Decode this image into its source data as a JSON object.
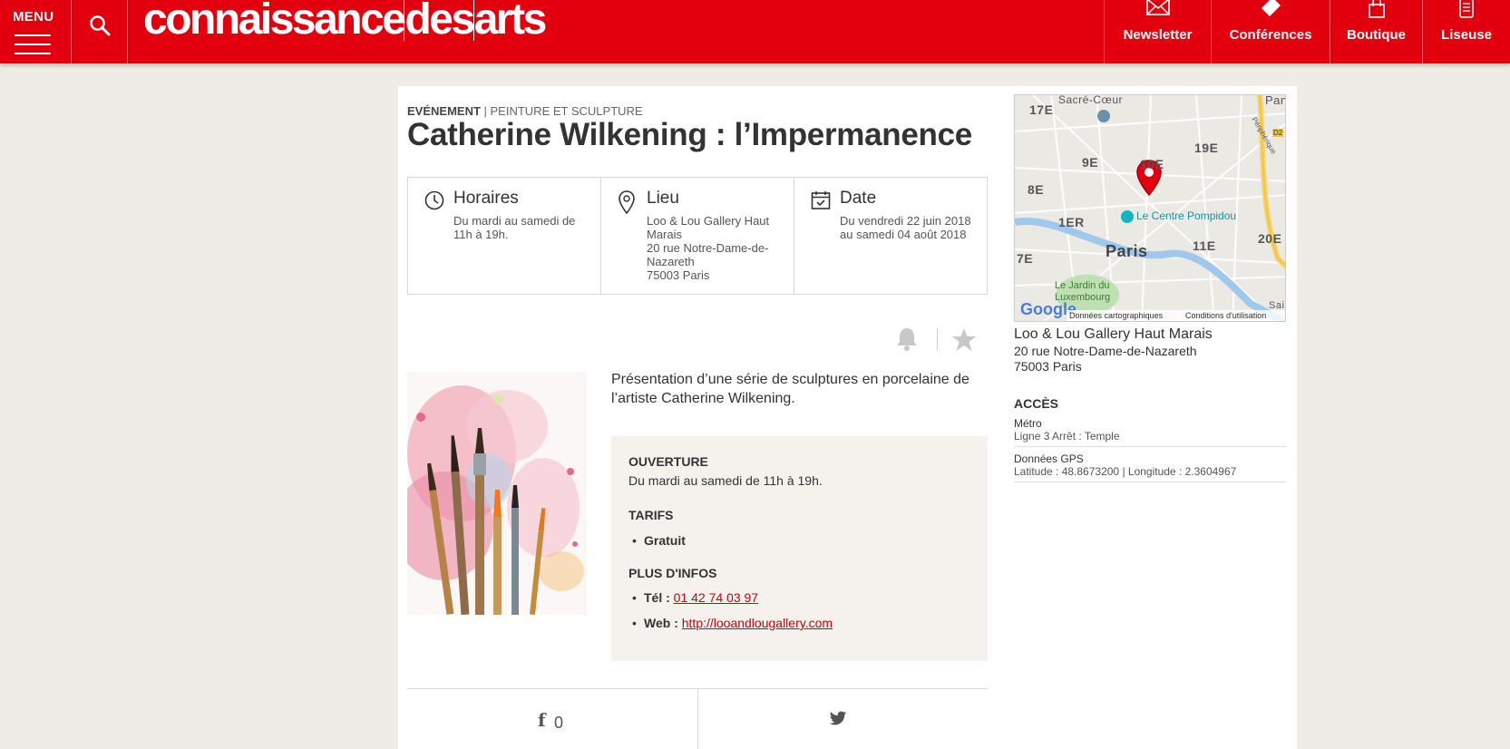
{
  "header": {
    "menu_label": "MENU",
    "logo_part1": "connaissance",
    "logo_part2": "des",
    "logo_part3": "arts",
    "nav": [
      {
        "label": "Newsletter",
        "icon": "envelope-icon"
      },
      {
        "label": "Conférences",
        "icon": "ticket-icon"
      },
      {
        "label": "Boutique",
        "icon": "shopping-bag-icon"
      },
      {
        "label": "Liseuse",
        "icon": "tablet-icon"
      }
    ]
  },
  "article": {
    "category_type": "EVÉNEMENT",
    "category_sep": " | ",
    "category_name": "PEINTURE ET SCULPTURE",
    "title": "Catherine Wilkening : l’Impermanence",
    "info": {
      "hours_title": "Horaires",
      "hours_text": "Du mardi au samedi de 11h à 19h.",
      "place_title": "Lieu",
      "place_lines": [
        "Loo & Lou Gallery Haut Marais",
        "20 rue Notre-Dame-de-Nazareth",
        "75003 Paris"
      ],
      "date_title": "Date",
      "date_text": "Du vendredi 22 juin 2018 au samedi 04 août 2018"
    },
    "description": "Présentation d’une série de sculptures en porcelaine de l’artiste Catherine Wilkening.",
    "details": {
      "opening_title": "OUVERTURE",
      "opening_text": "Du mardi au samedi de 11h à 19h.",
      "prices_title": "TARIFS",
      "price_item": "Gratuit",
      "more_title": "PLUS D'INFOS",
      "tel_label": "Tél : ",
      "tel_value": "01 42 74 03 97",
      "web_label": "Web : ",
      "web_value": "http://looandlougallery.com"
    },
    "share": {
      "facebook_glyph": "f",
      "facebook_count": "0"
    }
  },
  "sidebar": {
    "map": {
      "labels": [
        "Sacré-Cœur",
        "Pan",
        "17E",
        "19E",
        "9E",
        "10E",
        "8E",
        "1ER",
        "20E",
        "11E",
        "Paris",
        "7E",
        "Le Jardin du Luxembourg",
        "Sai",
        "Périphérique",
        "D2"
      ],
      "poi": "Le Centre Pompidou",
      "google": "Google",
      "credits": "Données cartographiques",
      "terms": "Conditions d'utilisation"
    },
    "venue_name": "Loo & Lou Gallery Haut Marais",
    "venue_street": "20 rue Notre-Dame-de-Nazareth",
    "venue_city": "75003 Paris",
    "access_title": "ACCÈS",
    "metro_title": "Métro",
    "metro_text": "Ligne 3 Arrêt : Temple",
    "gps_title": "Données GPS",
    "gps_text": "Latitude : 48.8673200 | Longitude : 2.3604967"
  },
  "colors": {
    "brand_red": "#e2000f",
    "link_red": "#c8000d",
    "page_bg": "#efebe7",
    "panel_bg": "#f5f2ee"
  }
}
